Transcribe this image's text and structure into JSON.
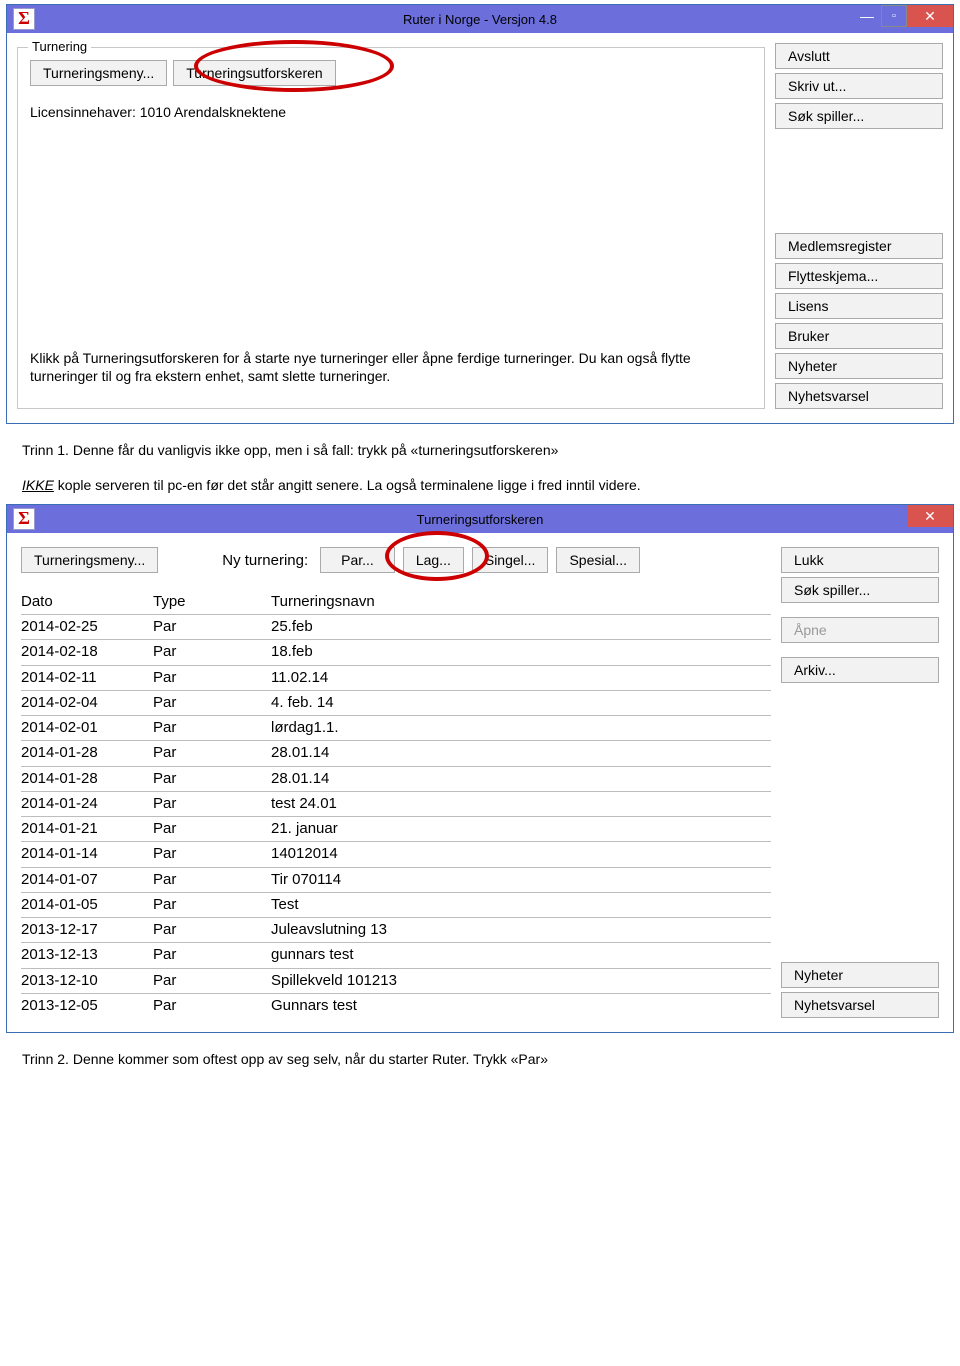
{
  "window1": {
    "title": "Ruter i Norge - Versjon 4.8",
    "fieldset_legend": "Turnering",
    "btn_meny": "Turneringsmeny...",
    "btn_utforsk": "Turneringsutforskeren",
    "licens": "Licensinnehaver: 1010 Arendalsknektene",
    "info": "Klikk på Turneringsutforskeren for å starte nye turneringer eller åpne ferdige turneringer. Du kan også flytte turneringer til og fra ekstern enhet, samt slette turneringer.",
    "right": {
      "avslutt": "Avslutt",
      "skrivut": "Skriv ut...",
      "sokspiller": "Søk spiller...",
      "medlemsreg": "Medlemsregister",
      "flytteskjema": "Flytteskjema...",
      "lisens": "Lisens",
      "bruker": "Bruker",
      "nyheter": "Nyheter",
      "nyhetsvarsel": "Nyhetsvarsel"
    }
  },
  "doc1": {
    "line1": "Trinn 1. Denne får du vanligvis ikke opp, men i så fall: trykk på «turneringsutforskeren»",
    "ikke": "IKKE",
    "line2_rest": " kople serveren til pc-en før det står angitt senere. La også terminalene ligge i fred inntil videre."
  },
  "window2": {
    "title": "Turneringsutforskeren",
    "btn_meny": "Turneringsmeny...",
    "ny_label": "Ny turnering:",
    "btn_par": "Par...",
    "btn_lag": "Lag...",
    "btn_singel": "Singel...",
    "btn_spesial": "Spesial...",
    "hdr_dato": "Dato",
    "hdr_type": "Type",
    "hdr_navn": "Turneringsnavn",
    "rows": [
      {
        "dato": "2014-02-25",
        "type": "Par",
        "navn": "25.feb"
      },
      {
        "dato": "2014-02-18",
        "type": "Par",
        "navn": "18.feb"
      },
      {
        "dato": "2014-02-11",
        "type": "Par",
        "navn": "11.02.14"
      },
      {
        "dato": "2014-02-04",
        "type": "Par",
        "navn": "4. feb. 14"
      },
      {
        "dato": "2014-02-01",
        "type": "Par",
        "navn": "lørdag1.1."
      },
      {
        "dato": "2014-01-28",
        "type": "Par",
        "navn": "28.01.14"
      },
      {
        "dato": "2014-01-28",
        "type": "Par",
        "navn": "28.01.14"
      },
      {
        "dato": "2014-01-24",
        "type": "Par",
        "navn": "test 24.01"
      },
      {
        "dato": "2014-01-21",
        "type": "Par",
        "navn": "21. januar"
      },
      {
        "dato": "2014-01-14",
        "type": "Par",
        "navn": "14012014"
      },
      {
        "dato": "2014-01-07",
        "type": "Par",
        "navn": "Tir 070114"
      },
      {
        "dato": "2014-01-05",
        "type": "Par",
        "navn": "Test"
      },
      {
        "dato": "2013-12-17",
        "type": "Par",
        "navn": "Juleavslutning 13"
      },
      {
        "dato": "2013-12-13",
        "type": "Par",
        "navn": "gunnars test"
      },
      {
        "dato": "2013-12-10",
        "type": "Par",
        "navn": "Spillekveld 101213"
      },
      {
        "dato": "2013-12-05",
        "type": "Par",
        "navn": "Gunnars test"
      }
    ],
    "right": {
      "lukk": "Lukk",
      "sokspiller": "Søk spiller...",
      "apne": "Åpne",
      "arkiv": "Arkiv...",
      "nyheter": "Nyheter",
      "nyhetsvarsel": "Nyhetsvarsel"
    }
  },
  "doc2": {
    "text": "Trinn 2. Denne kommer som oftest opp av seg selv, når du starter Ruter. Trykk «Par»"
  },
  "sigma": "Σ",
  "min": "—",
  "max": "▫",
  "close": "✕"
}
